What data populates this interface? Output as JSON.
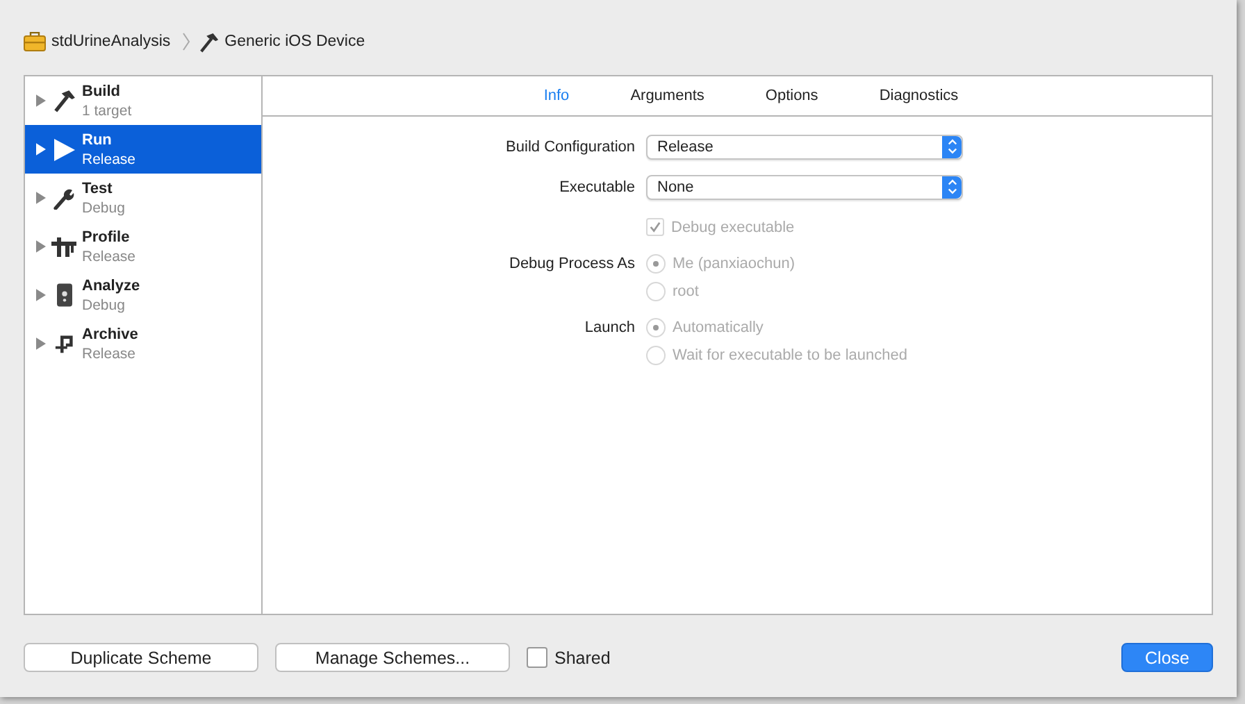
{
  "breadcrumb": [
    {
      "label": "stdUrineAnalysis",
      "kind": "project"
    },
    {
      "label": "Generic iOS Device",
      "kind": "device"
    }
  ],
  "actions": [
    {
      "name": "Build",
      "detail": "1 target",
      "kind": "build",
      "selected": false
    },
    {
      "name": "Run",
      "detail": "Release",
      "kind": "run",
      "selected": true
    },
    {
      "name": "Test",
      "detail": "Debug",
      "kind": "test",
      "selected": false
    },
    {
      "name": "Profile",
      "detail": "Release",
      "kind": "profile",
      "selected": false
    },
    {
      "name": "Analyze",
      "detail": "Debug",
      "kind": "analyze",
      "selected": false
    },
    {
      "name": "Archive",
      "detail": "Release",
      "kind": "archive",
      "selected": false
    }
  ],
  "tabs": [
    {
      "label": "Info",
      "selected": true
    },
    {
      "label": "Arguments",
      "selected": false
    },
    {
      "label": "Options",
      "selected": false
    },
    {
      "label": "Diagnostics",
      "selected": false
    }
  ],
  "form": [
    {
      "kind": "select",
      "label": "Build Configuration",
      "value": "Release"
    },
    {
      "kind": "select",
      "label": "Executable",
      "value": "None"
    },
    {
      "kind": "checkbox",
      "text": "Debug executable",
      "checked": true,
      "disabled": true
    },
    {
      "kind": "radio",
      "label": "Debug Process As",
      "options": [
        {
          "text": "Me (panxiaochun)",
          "selected": true
        },
        {
          "text": "root",
          "selected": false
        }
      ],
      "disabled": true
    },
    {
      "kind": "radio",
      "label": "Launch",
      "options": [
        {
          "text": "Automatically",
          "selected": true
        },
        {
          "text": "Wait for executable to be launched",
          "selected": false
        }
      ],
      "disabled": true
    }
  ],
  "buttons": [
    {
      "label": "Duplicate Scheme"
    },
    {
      "label": "Manage Schemes..."
    }
  ],
  "shared": {
    "label": "Shared",
    "checked": false
  },
  "close_button": {
    "label": "Close"
  }
}
